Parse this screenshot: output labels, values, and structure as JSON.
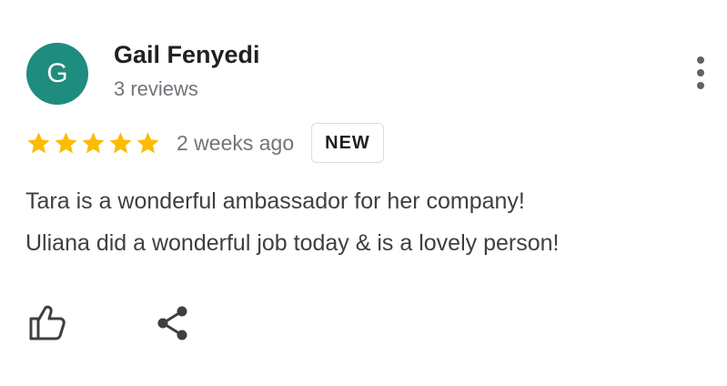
{
  "reviewer": {
    "initial": "G",
    "name": "Gail Fenyedi",
    "reviews": "3 reviews",
    "avatar_color": "#1e8c7e"
  },
  "review": {
    "rating": 5,
    "max_rating": 5,
    "time_ago": "2 weeks ago",
    "badge": "NEW",
    "text_lines": [
      "Tara is a wonderful ambassador for her company!",
      "Uliana did a wonderful job today & is a lovely person!"
    ]
  },
  "actions": {
    "like_icon": "thumb-up-outline",
    "share_icon": "share",
    "more_icon": "more-vertical"
  },
  "colors": {
    "star": "#fbbc04",
    "icon": "#3c4043",
    "secondary_text": "#70757a"
  }
}
